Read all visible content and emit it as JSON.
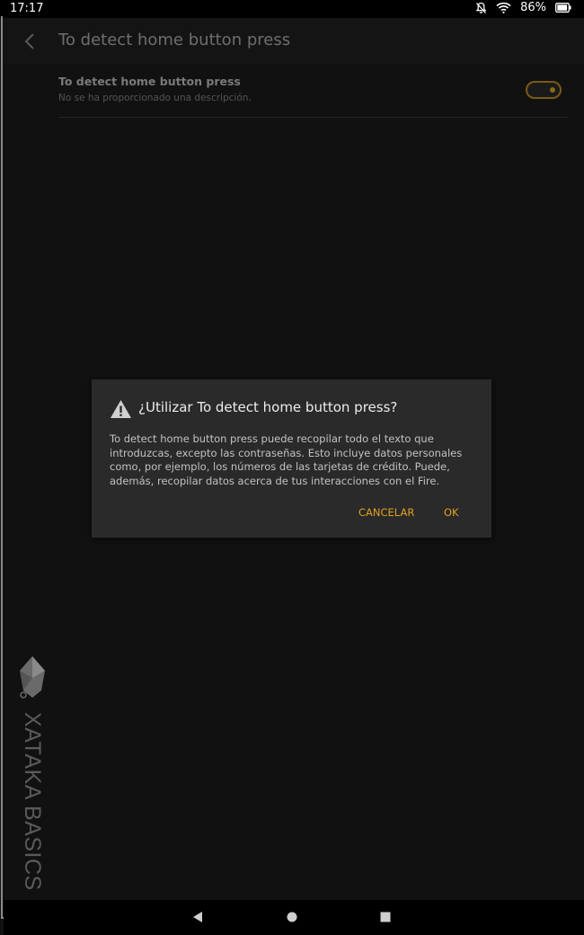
{
  "status_bar": {
    "time": "17:17",
    "battery_percent": "86%",
    "icons": [
      "notifications-off-icon",
      "wifi-icon",
      "battery-icon"
    ]
  },
  "app_bar": {
    "title": "To detect home button press"
  },
  "setting": {
    "title": "To detect home button press",
    "description": "No se ha proporcionado una descripción.",
    "toggle_on": true
  },
  "dialog": {
    "title": "¿Utilizar To detect home button press?",
    "body": "To detect home button press puede recopilar todo el texto que introduzcas, excepto las contraseñas. Esto incluye datos personales como, por ejemplo, los números de las tarjetas de crédito. Puede, además, recopilar datos acerca de tus interacciones con el Fire.",
    "cancel_label": "CANCELAR",
    "ok_label": "OK"
  },
  "watermark": {
    "text": "XATAKA BASICS"
  },
  "colors": {
    "accent": "#e0a020",
    "background": "#111111",
    "dialog_background": "#2a2a2a"
  }
}
